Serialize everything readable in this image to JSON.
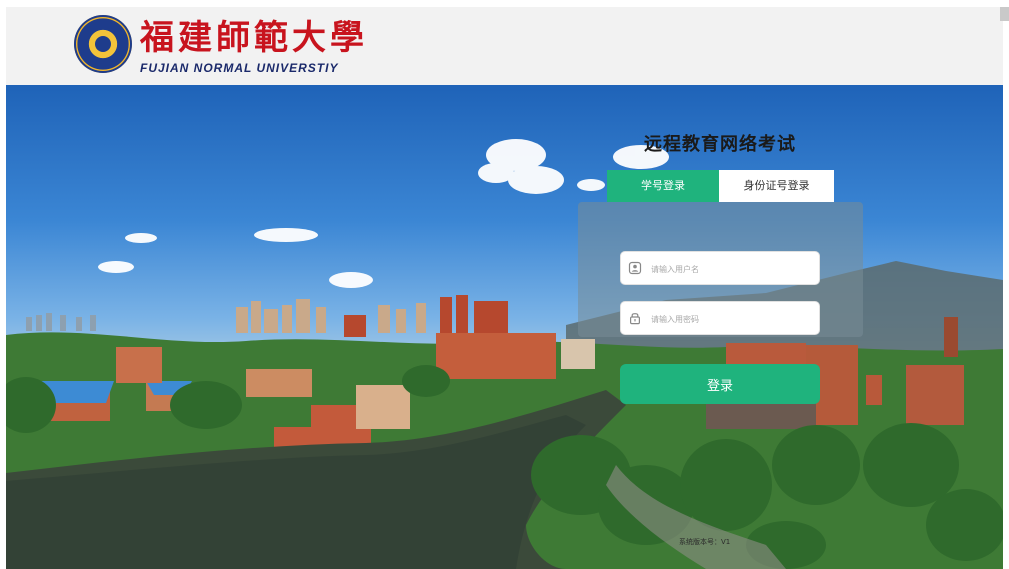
{
  "header": {
    "logo_cn": "福建師範大學",
    "logo_en": "FUJIAN NORMAL UNIVERSTIY"
  },
  "login": {
    "title": "远程教育网络考试",
    "tabs": [
      {
        "label": "学号登录",
        "active": true
      },
      {
        "label": "身份证号登录",
        "active": false
      }
    ],
    "username": {
      "placeholder": "请输入用户名",
      "icon": "user-icon"
    },
    "password": {
      "placeholder": "请输入用密码",
      "icon": "lock-icon"
    },
    "submit_label": "登录"
  },
  "footer": {
    "text": "系统版本号：V1"
  },
  "colors": {
    "accent": "#1fb37d",
    "logo_red": "#c8141e",
    "logo_blue": "#1b2a6b",
    "header_bg": "#f2f2f2"
  }
}
